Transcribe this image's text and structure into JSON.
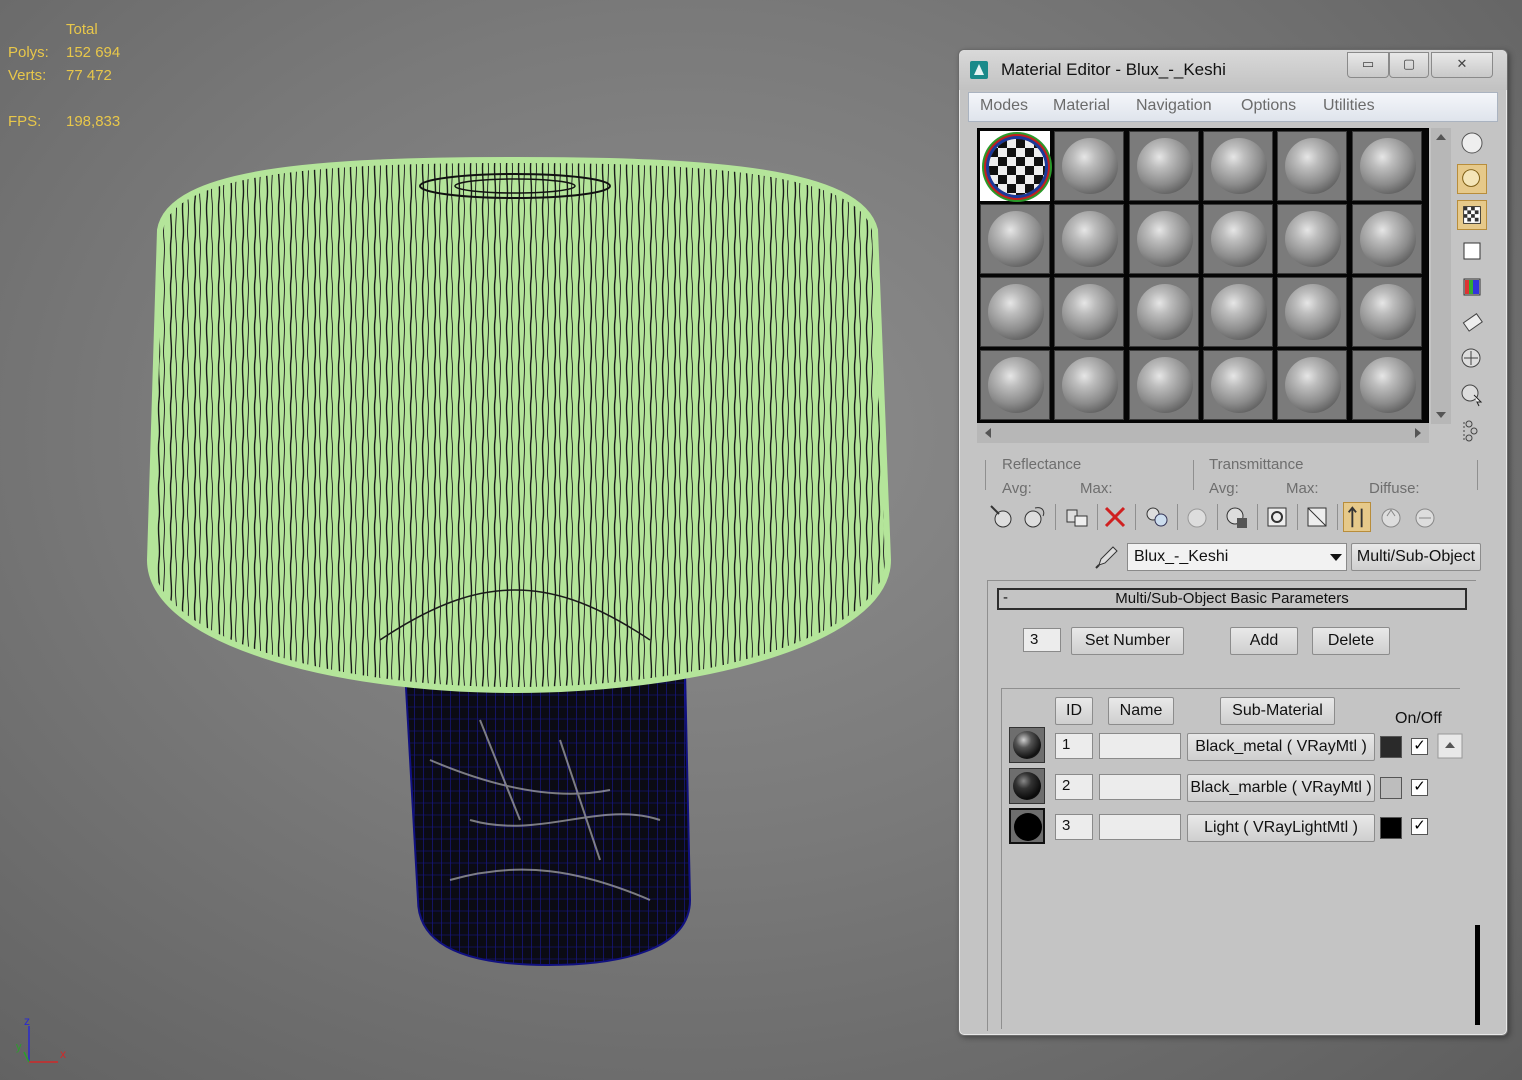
{
  "viewport": {
    "stats": {
      "header": "Total",
      "polys_label": "Polys:",
      "polys_value": "152 694",
      "verts_label": "Verts:",
      "verts_value": "77 472",
      "fps_label": "FPS:",
      "fps_value": "198,833"
    },
    "gizmo": {
      "z": "z",
      "y": "y",
      "x": "x"
    }
  },
  "editor": {
    "title": "Material Editor - Blux_-_Keshi",
    "window_buttons": [
      "▭",
      "▢",
      "✕"
    ],
    "menu": [
      "Modes",
      "Material",
      "Navigation",
      "Options",
      "Utilities"
    ],
    "slots": {
      "rows": 4,
      "cols": 6,
      "selected": 0
    },
    "reflectance": {
      "label": "Reflectance",
      "avg": "Avg:",
      "max": "Max:"
    },
    "transmittance": {
      "label": "Transmittance",
      "avg": "Avg:",
      "max": "Max:",
      "diffuse": "Diffuse:"
    },
    "material_name": "Blux_-_Keshi",
    "material_type": "Multi/Sub-Object",
    "rollout": {
      "title": "Multi/Sub-Object Basic Parameters",
      "collapse": "-",
      "count": "3",
      "set_number": "Set Number",
      "add": "Add",
      "delete": "Delete",
      "col_id": "ID",
      "col_name": "Name",
      "col_sub": "Sub-Material",
      "col_onoff": "On/Off",
      "rows": [
        {
          "id": "1",
          "name": "",
          "sub": "Black_metal  ( VRayMtl )",
          "swatch": "#2a2a2a",
          "on": "✓"
        },
        {
          "id": "2",
          "name": "",
          "sub": "Black_marble  ( VRayMtl )",
          "swatch": "#bdbdbd",
          "on": "✓"
        },
        {
          "id": "3",
          "name": "",
          "sub": "Light  ( VRayLightMtl )",
          "swatch": "#000000",
          "on": "✓"
        }
      ]
    },
    "colors": {
      "menu_text": "#6b6b6b",
      "active_tool": "#e6c98a"
    }
  }
}
